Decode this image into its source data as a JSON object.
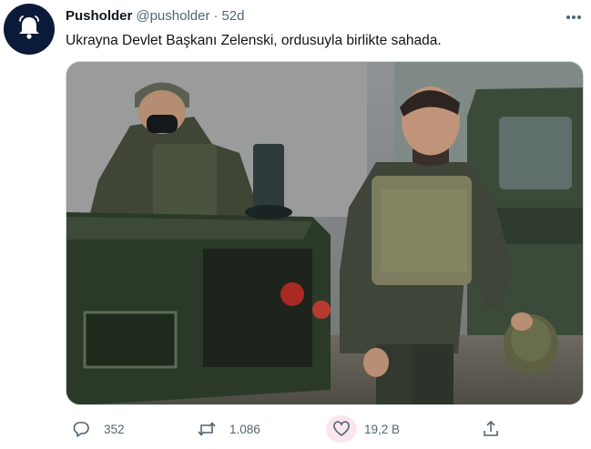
{
  "tweet": {
    "author_name": "Pusholder",
    "handle": "@pusholder",
    "separator": "·",
    "time": "52d",
    "text": "Ukrayna Devlet Başkanı Zelenski, ordusuyla birlikte sahada.",
    "avatar_icon": "bell-icon",
    "avatar_bg": "#0b1a38"
  },
  "actions": {
    "reply_count": "352",
    "retweet_count": "1.086",
    "like_count": "19,2 B",
    "reply_icon": "speech-bubble-icon",
    "retweet_icon": "retweet-icon",
    "like_icon": "heart-icon",
    "share_icon": "share-icon"
  },
  "colors": {
    "text_primary": "#0f1419",
    "text_secondary": "#536471",
    "like_highlight": "#fbe6ef"
  }
}
